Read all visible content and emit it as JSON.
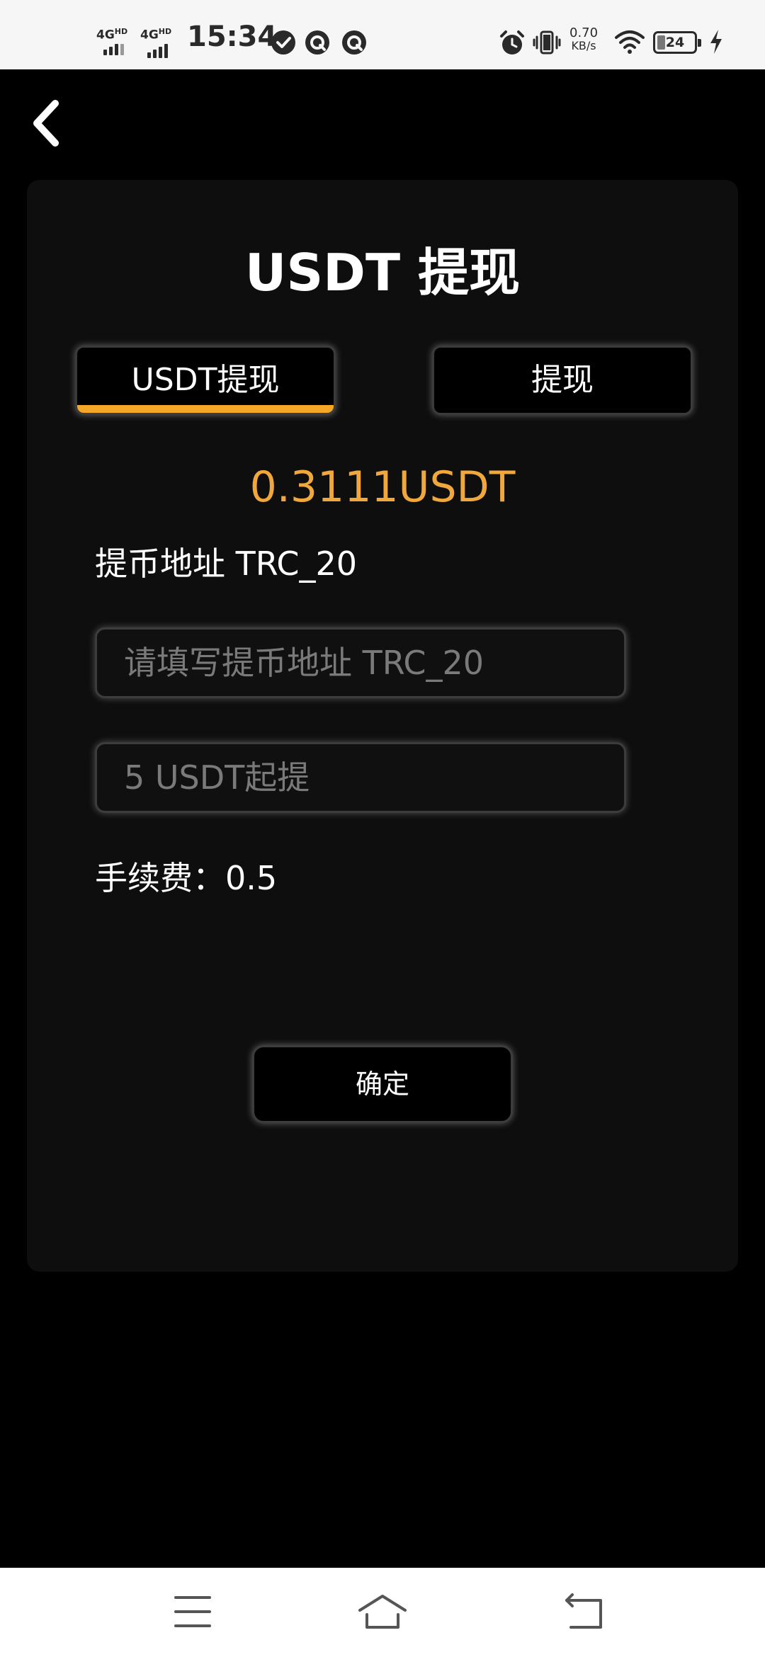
{
  "status_bar": {
    "sim1_label": "4G",
    "sim1_sup": "HD",
    "sim2_label": "4G",
    "sim2_sup": "HD",
    "time": "15:34",
    "network_speed_value": "0.70",
    "network_speed_unit": "KB/s",
    "battery_level": "24",
    "icons": [
      "check-circle-icon",
      "q-app-icon",
      "q-app-icon",
      "alarm-icon",
      "vibrate-icon",
      "wifi-icon",
      "battery-icon",
      "charging-bolt-icon"
    ]
  },
  "header": {
    "back_icon": "chevron-left-icon"
  },
  "main": {
    "title": "USDT 提现",
    "tabs": [
      {
        "label": "USDT提现",
        "active": true
      },
      {
        "label": "提现",
        "active": false
      }
    ],
    "balance": "0.3111USDT",
    "address_label": "提币地址 TRC_20",
    "address_input": {
      "value": "",
      "placeholder": "请填写提币地址 TRC_20"
    },
    "amount_input": {
      "value": "",
      "placeholder": "5 USDT起提"
    },
    "fee_text": "手续费：0.5",
    "confirm_label": "确定"
  },
  "colors": {
    "accent": "#f4a726",
    "balance": "#f0a73c",
    "card_bg": "#0e0e0e",
    "page_bg": "#000000"
  },
  "nav_bar": {
    "icons": [
      "menu-icon",
      "home-icon",
      "back-icon"
    ]
  }
}
